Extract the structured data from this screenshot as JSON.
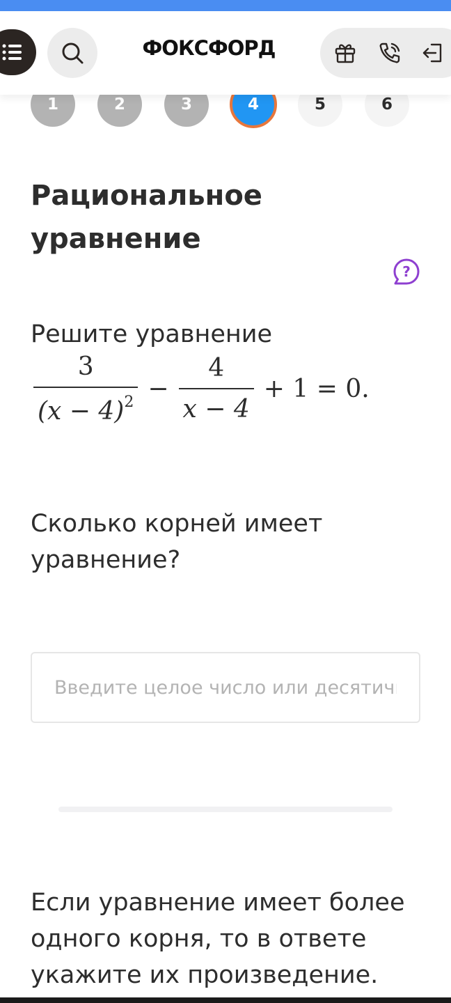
{
  "header": {
    "logo": "ФОКСФОРД",
    "icons": [
      "menu-icon",
      "search-icon",
      "gift-icon",
      "phone-icon",
      "logout-icon"
    ]
  },
  "steps": [
    {
      "label": "1",
      "state": "done"
    },
    {
      "label": "2",
      "state": "done"
    },
    {
      "label": "3",
      "state": "done"
    },
    {
      "label": "4",
      "state": "current"
    },
    {
      "label": "5",
      "state": "todo"
    },
    {
      "label": "6",
      "state": "todo"
    }
  ],
  "task": {
    "title": "Рациональное уравнение",
    "prompt": "Решите уравнение",
    "formula": {
      "frac1_num": "3",
      "frac1_den": "(x − 4)",
      "frac1_exp": "2",
      "minus": "−",
      "frac2_num": "4",
      "frac2_den": "x − 4",
      "tail": "+ 1 = 0."
    },
    "question": "Сколько корней имеет уравнение?",
    "answer_placeholder": "Введите целое число или десятичную дробь",
    "answer_value": "",
    "note": "Если уравнение имеет более одного корня, то в ответе укажите их произведение."
  },
  "colors": {
    "accent": "#2196f3",
    "current_ring": "#e8773c",
    "help": "#8e3fd0",
    "topbar": "#4a8df2"
  }
}
